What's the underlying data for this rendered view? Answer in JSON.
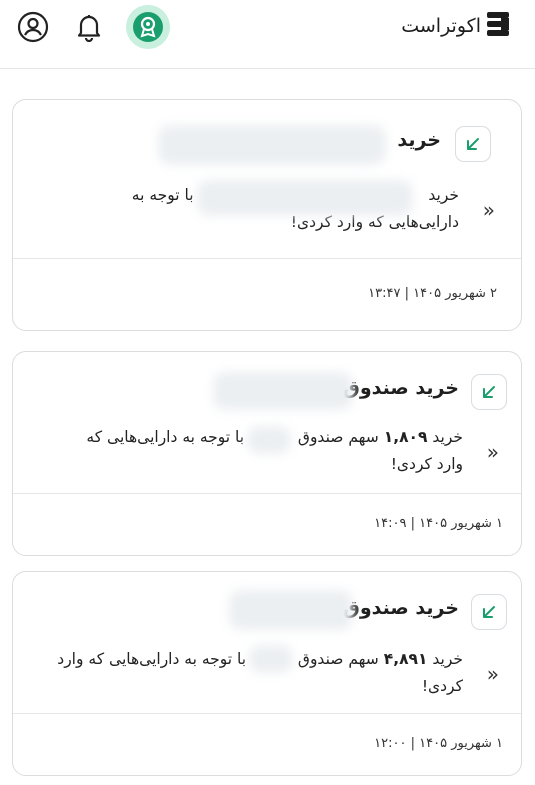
{
  "header": {
    "brand": "اکوتراست",
    "icons": [
      "brand-logo-icon",
      "badge-icon",
      "bell-icon",
      "user-icon"
    ],
    "accent": "#1a9e6e"
  },
  "notifications": [
    {
      "title": "خرید",
      "line1_a": "خرید",
      "line1_b": "با توجه به",
      "line2": "دارایی‌هایی که وارد کردی!",
      "date": "۲ شهریور ۱۴۰۵ | ۱۳:۴۷"
    },
    {
      "title": "خرید صندوق",
      "line1_a": "خرید",
      "amount": "۱,۸۰۹",
      "line1_b": "سهم صندوق",
      "line1_c": "با توجه به دارایی‌هایی که",
      "line2": "وارد کردی!",
      "date": "۱ شهریور ۱۴۰۵ | ۱۴:۰۹"
    },
    {
      "title": "خرید صندوق",
      "line1_a": "خرید",
      "amount": "۴,۸۹۱",
      "line1_b": "سهم صندوق",
      "line1_c": "با توجه به دارایی‌هایی که وارد",
      "line2": "کردی!",
      "date": "۱ شهریور ۱۴۰۵ | ۱۲:۰۰"
    }
  ]
}
